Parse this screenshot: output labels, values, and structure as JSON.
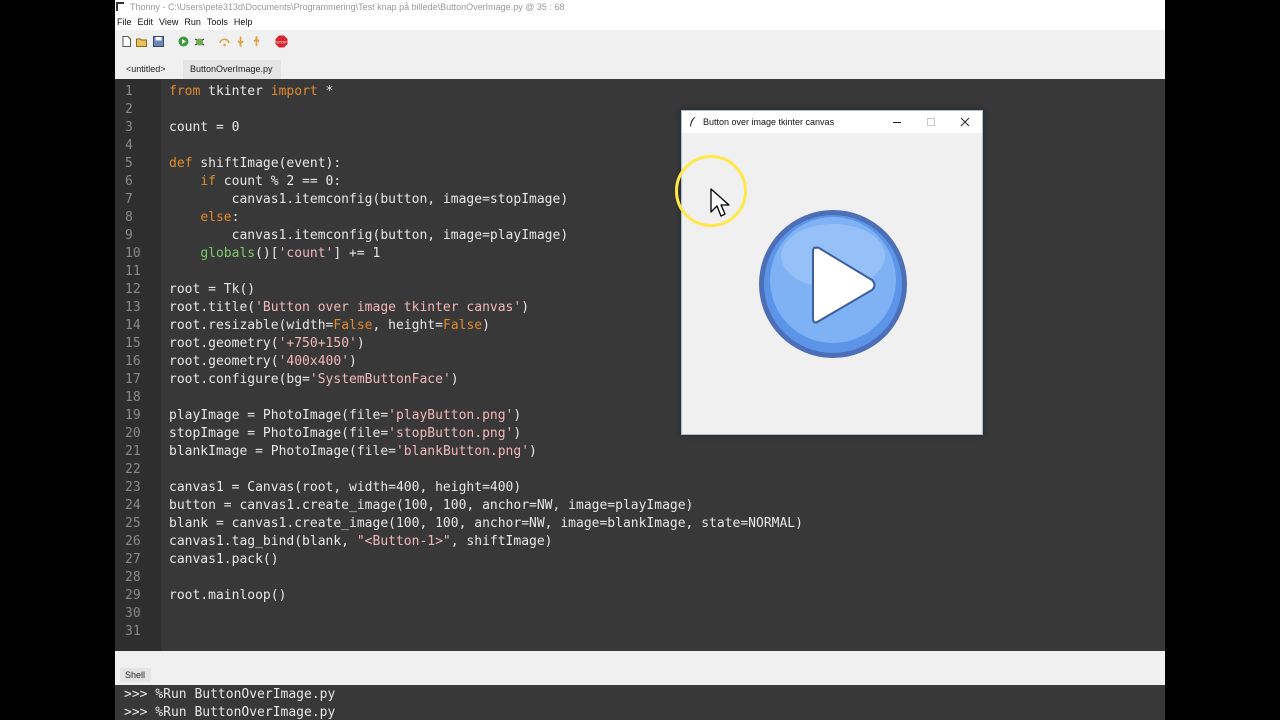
{
  "window": {
    "title": "Thonny  -  C:\\Users\\pete313d\\Documents\\Programmering\\Test knap på billede\\ButtonOverImage.py  @  35 : 68"
  },
  "menu": [
    "File",
    "Edit",
    "View",
    "Run",
    "Tools",
    "Help"
  ],
  "toolbar": {
    "icons": [
      "new-file-icon",
      "open-file-icon",
      "save-icon",
      "run-icon",
      "debug-icon",
      "step-over-icon",
      "step-into-icon",
      "step-out-icon",
      "stop-icon"
    ],
    "stop_label": "STOP"
  },
  "tabs": [
    {
      "label": "<untitled>",
      "active": false
    },
    {
      "label": "ButtonOverImage.py",
      "active": true
    }
  ],
  "editor": {
    "line_numbers": [
      "1",
      "2",
      "3",
      "4",
      "5",
      "6",
      "7",
      "8",
      "9",
      "10",
      "11",
      "12",
      "13",
      "14",
      "15",
      "16",
      "17",
      "18",
      "19",
      "20",
      "21",
      "22",
      "23",
      "24",
      "25",
      "26",
      "27",
      "28",
      "29",
      "30",
      "31"
    ],
    "lines": [
      [
        {
          "t": "from",
          "c": "kw"
        },
        {
          "t": " tkinter "
        },
        {
          "t": "import",
          "c": "kw"
        },
        {
          "t": " *"
        }
      ],
      [],
      [
        {
          "t": "count = 0"
        }
      ],
      [],
      [
        {
          "t": "def",
          "c": "kw"
        },
        {
          "t": " shiftImage(event):"
        }
      ],
      [
        {
          "t": "    "
        },
        {
          "t": "if",
          "c": "kw"
        },
        {
          "t": " count % 2 == 0:"
        }
      ],
      [
        {
          "t": "        canvas1.itemconfig(button, image=stopImage)"
        }
      ],
      [
        {
          "t": "    "
        },
        {
          "t": "else",
          "c": "kw"
        },
        {
          "t": ":"
        }
      ],
      [
        {
          "t": "        canvas1.itemconfig(button, image=playImage)"
        }
      ],
      [
        {
          "t": "    "
        },
        {
          "t": "globals",
          "c": "bi"
        },
        {
          "t": "()["
        },
        {
          "t": "'count'",
          "c": "st"
        },
        {
          "t": "] += 1"
        }
      ],
      [],
      [
        {
          "t": "root = Tk()"
        }
      ],
      [
        {
          "t": "root.title("
        },
        {
          "t": "'Button over image tkinter canvas'",
          "c": "st"
        },
        {
          "t": ")"
        }
      ],
      [
        {
          "t": "root.resizable(width="
        },
        {
          "t": "False",
          "c": "kw"
        },
        {
          "t": ", height="
        },
        {
          "t": "False",
          "c": "kw"
        },
        {
          "t": ")"
        }
      ],
      [
        {
          "t": "root.geometry("
        },
        {
          "t": "'+750+150'",
          "c": "st"
        },
        {
          "t": ")"
        }
      ],
      [
        {
          "t": "root.geometry("
        },
        {
          "t": "'400x400'",
          "c": "st"
        },
        {
          "t": ")"
        }
      ],
      [
        {
          "t": "root.configure(bg="
        },
        {
          "t": "'SystemButtonFace'",
          "c": "st"
        },
        {
          "t": ")"
        }
      ],
      [],
      [
        {
          "t": "playImage = PhotoImage(file="
        },
        {
          "t": "'playButton.png'",
          "c": "st"
        },
        {
          "t": ")"
        }
      ],
      [
        {
          "t": "stopImage = PhotoImage(file="
        },
        {
          "t": "'stopButton.png'",
          "c": "st"
        },
        {
          "t": ")"
        }
      ],
      [
        {
          "t": "blankImage = PhotoImage(file="
        },
        {
          "t": "'blankButton.png'",
          "c": "st"
        },
        {
          "t": ")"
        }
      ],
      [],
      [
        {
          "t": "canvas1 = Canvas(root, width=400, height=400)"
        }
      ],
      [
        {
          "t": "button = canvas1.create_image(100, 100, anchor=NW, image=playImage)"
        }
      ],
      [
        {
          "t": "blank = canvas1.create_image(100, 100, anchor=NW, image=blankImage, state=NORMAL)"
        }
      ],
      [
        {
          "t": "canvas1.tag_bind(blank, "
        },
        {
          "t": "\"<Button-1>\"",
          "c": "st"
        },
        {
          "t": ", shiftImage)"
        }
      ],
      [
        {
          "t": "canvas1.pack()"
        }
      ],
      [],
      [
        {
          "t": "root.mainloop()"
        }
      ],
      [],
      []
    ]
  },
  "shell": {
    "label": "Shell",
    "lines": [
      ">>> %Run ButtonOverImage.py",
      ">>> %Run ButtonOverImage.py"
    ]
  },
  "tk_window": {
    "title": "Button over image tkinter canvas",
    "minimize": "—",
    "maximize": "☐",
    "close": "✕"
  },
  "colors": {
    "keyword": "#e08a2e",
    "string": "#f2b8b8",
    "builtin": "#7ecb6b",
    "editor_bg": "#383838",
    "play_button": "#4f86e3"
  }
}
